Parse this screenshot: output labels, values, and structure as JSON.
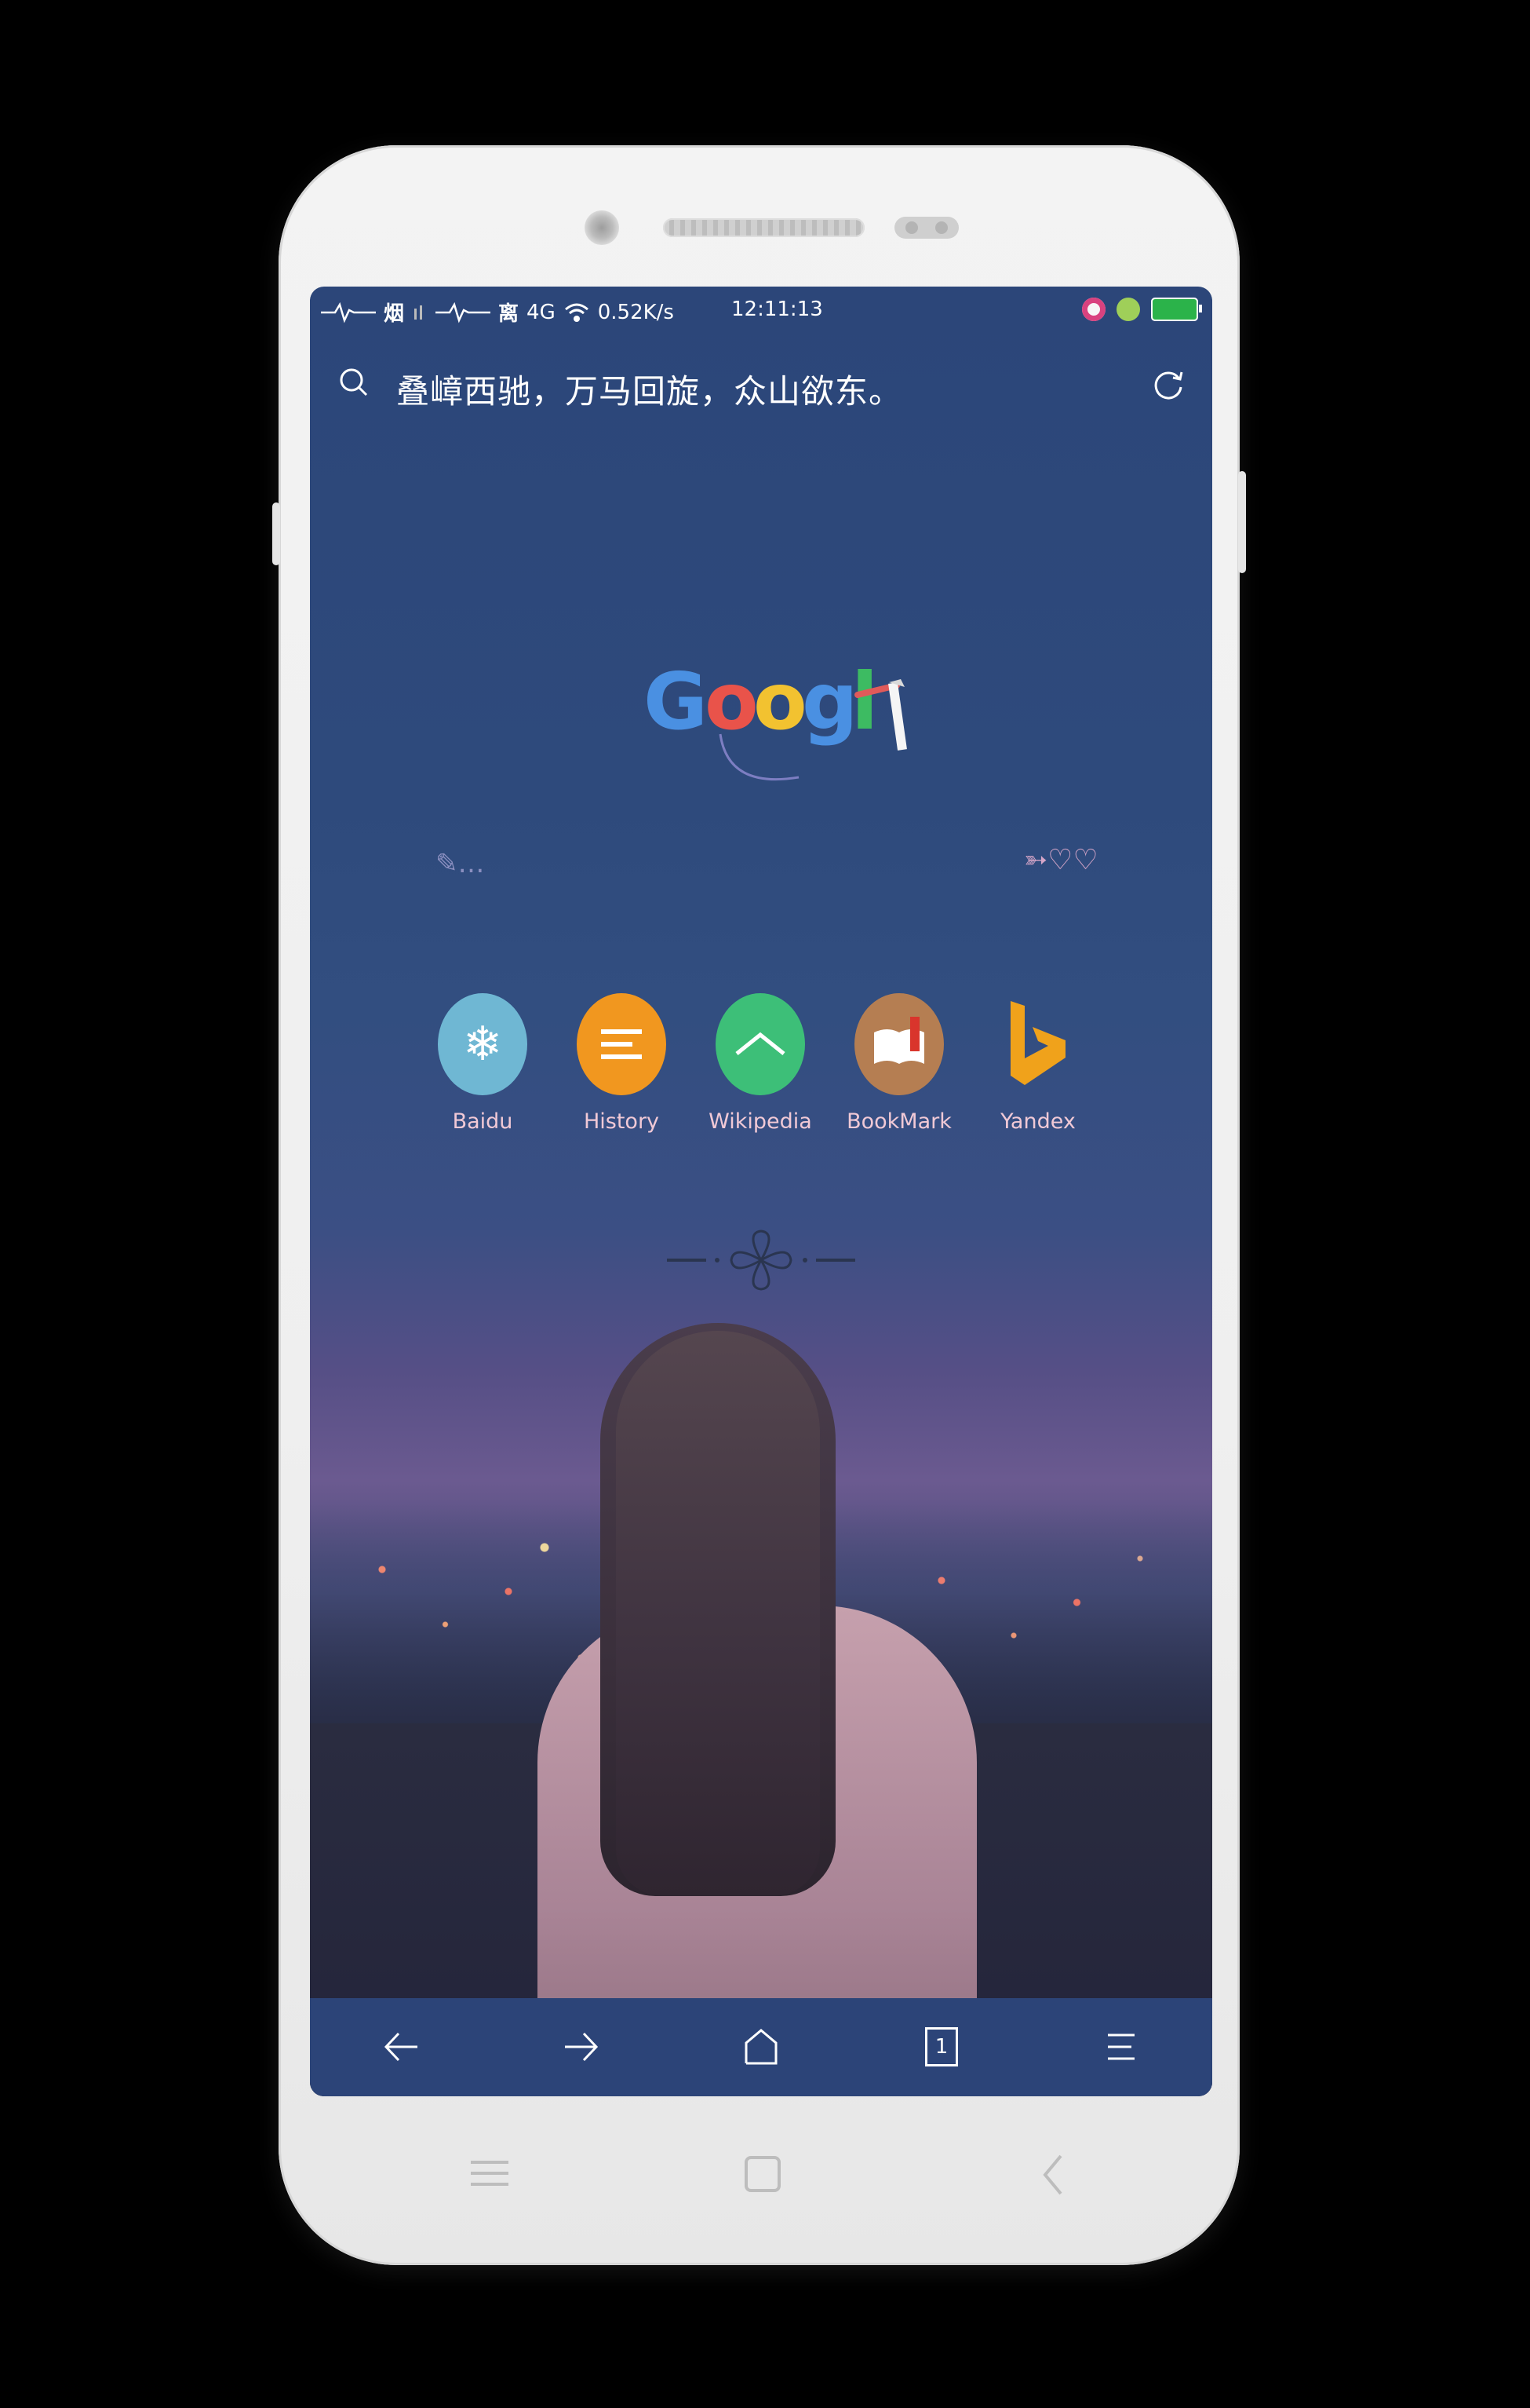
{
  "status_bar": {
    "left_text_1": "烟",
    "left_text_2": "离",
    "network": "4G",
    "speed": "0.52K/s",
    "time": "12:11:13"
  },
  "search": {
    "text": "叠嶂西驰，万马回旋，众山欲东。"
  },
  "logo": {
    "letters": [
      "G",
      "o",
      "o",
      "g",
      "l"
    ]
  },
  "shortcuts": [
    {
      "label": "Baidu",
      "color": "#6fb7d3",
      "icon": "snowflake-icon"
    },
    {
      "label": "History",
      "color": "#f1971f",
      "icon": "menu-lines-icon"
    },
    {
      "label": "Wikipedia",
      "color": "#3dbf78",
      "icon": "chevron-up-icon"
    },
    {
      "label": "BookMark",
      "color": "#b57e52",
      "icon": "book-icon"
    },
    {
      "label": "Yandex",
      "color": "#f0a21b",
      "icon": "bing-icon"
    }
  ],
  "bottom_nav": {
    "tab_count": "1"
  },
  "colors": {
    "toolbar": "#2c4478",
    "label_pink": "#f1c9d6"
  }
}
